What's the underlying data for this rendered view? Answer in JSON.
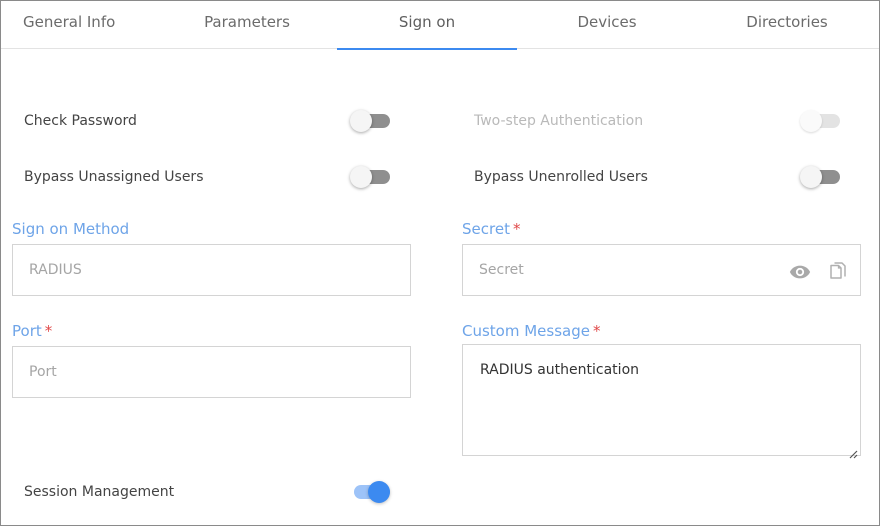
{
  "tabs": [
    {
      "label": "General Info"
    },
    {
      "label": "Parameters"
    },
    {
      "label": "Sign on"
    },
    {
      "label": "Devices"
    },
    {
      "label": "Directories"
    }
  ],
  "toggles": {
    "check_password": {
      "label": "Check Password",
      "on": false
    },
    "two_step": {
      "label": "Two-step Authentication",
      "on": false,
      "disabled": true
    },
    "bypass_unassigned": {
      "label": "Bypass Unassigned Users",
      "on": false
    },
    "bypass_unenrolled": {
      "label": "Bypass Unenrolled Users",
      "on": false
    },
    "session_management": {
      "label": "Session Management",
      "on": true
    }
  },
  "fields": {
    "sign_on_method": {
      "label": "Sign on Method",
      "value": "RADIUS"
    },
    "secret": {
      "label": "Secret",
      "required_mark": "*",
      "placeholder": "Secret"
    },
    "port": {
      "label": "Port",
      "required_mark": "*",
      "placeholder": "Port"
    },
    "custom_message": {
      "label": "Custom Message",
      "required_mark": "*",
      "value": "RADIUS authentication"
    }
  },
  "colors": {
    "accent": "#3c8af0",
    "label": "#6ea4e8",
    "required": "#e04848"
  },
  "icons": {
    "show_secret": "eye-icon",
    "copy_secret": "copy-icon"
  }
}
